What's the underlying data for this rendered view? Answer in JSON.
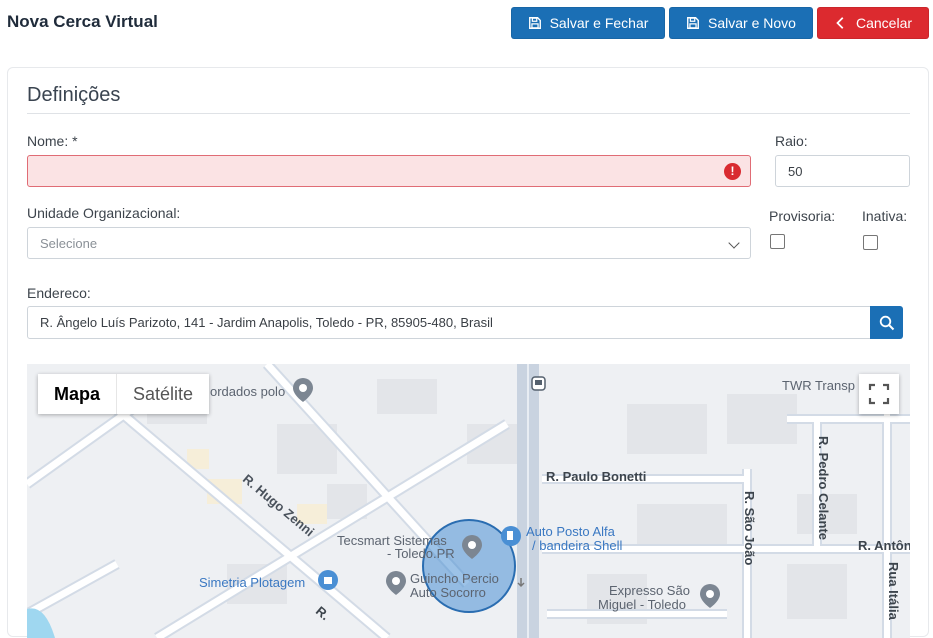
{
  "header": {
    "title": "Nova Cerca Virtual",
    "save_close_label": "Salvar e Fechar",
    "save_new_label": "Salvar e Novo",
    "cancel_label": "Cancelar"
  },
  "form": {
    "section_title": "Definições",
    "name_label": "Nome: *",
    "name_value": "",
    "raio_label": "Raio:",
    "raio_value": "50",
    "unit_label": "Unidade Organizacional:",
    "unit_placeholder": "Selecione",
    "provisoria_label": "Provisoria:",
    "inativa_label": "Inativa:",
    "endereco_label": "Endereco:",
    "endereco_value": "R. Ângelo Luís Parizoto, 141 - Jardim Anapolis, Toledo - PR, 85905-480, Brasil"
  },
  "map": {
    "type_map": "Mapa",
    "type_satellite": "Satélite",
    "labels": {
      "bordados": "ordados polo",
      "twr": "TWR Transp",
      "hugo": "R. Hugo Zenni",
      "paulo": "R. Paulo Bonetti",
      "pedro": "R. Pedro Celante",
      "saojoao": "R. São João",
      "antonio": "R. Antôn",
      "rua_italia": "Rua Itália",
      "tecsmart": "Tecsmart Sistemas",
      "tecsmart2": "- Toledo.PR",
      "posto": "Auto Posto Alfa",
      "posto2": "/ bandeira Shell",
      "simetria": "Simetria Plotagem",
      "guincho": "Guincho Percio",
      "guincho2": "Auto Socorro",
      "expresso": "Expresso São",
      "expresso2": "Miguel - Toledo",
      "r_bottom": "R."
    }
  },
  "colors": {
    "primary": "#1b6fb5",
    "danger": "#dc2a2f",
    "geofence_fill": "#4a8fd4"
  }
}
